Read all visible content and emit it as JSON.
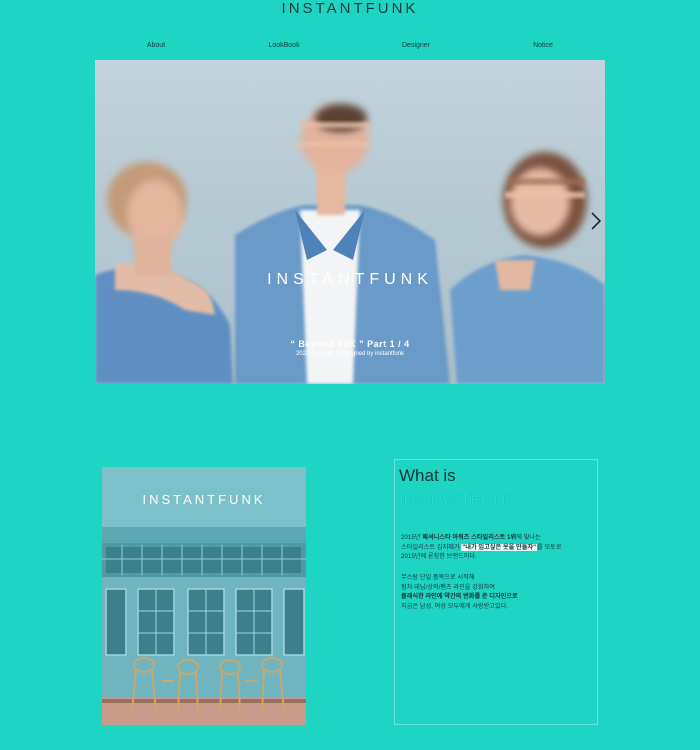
{
  "header": {
    "brand": "INSTANTFUNK"
  },
  "nav": {
    "items": [
      {
        "label": "About"
      },
      {
        "label": "LookBook"
      },
      {
        "label": "Designer"
      },
      {
        "label": "Notice"
      }
    ]
  },
  "hero": {
    "title": "INSTANTFUNK",
    "caption": "“ Beyond Y2K ” Part 1 / 4",
    "subcaption": "2022 S/S Part 1 Designed by instantfunk",
    "next_icon": "chevron-right-icon"
  },
  "store": {
    "sign": "INSTANTFUNK"
  },
  "about": {
    "heading_line1": "What is",
    "heading_line2": "INSTANTFUNK?",
    "p1": {
      "l1_a": "2015년 ",
      "l1_b": "패셔니스타 아워즈 스타일리스트 1위",
      "l1_c": "에 빛나는",
      "l2_a": "스타일리스트 김지혜가 ",
      "l2_b": "\"내가 입고싶은 옷을 만들자\"",
      "l2_c": "를 모토로",
      "l3": "2015년에 론칭한 브랜드이다."
    },
    "p2": {
      "l1": "무스탕 단일 품목으로 시작해",
      "l2": "점차 데님/상의/팬츠 라인을 강화하여",
      "l3": "클래식한 라인에 약간의 변화를 준 디자인으로",
      "l4": "지금은 남성, 여성 모두에게 사랑받고있다."
    }
  }
}
